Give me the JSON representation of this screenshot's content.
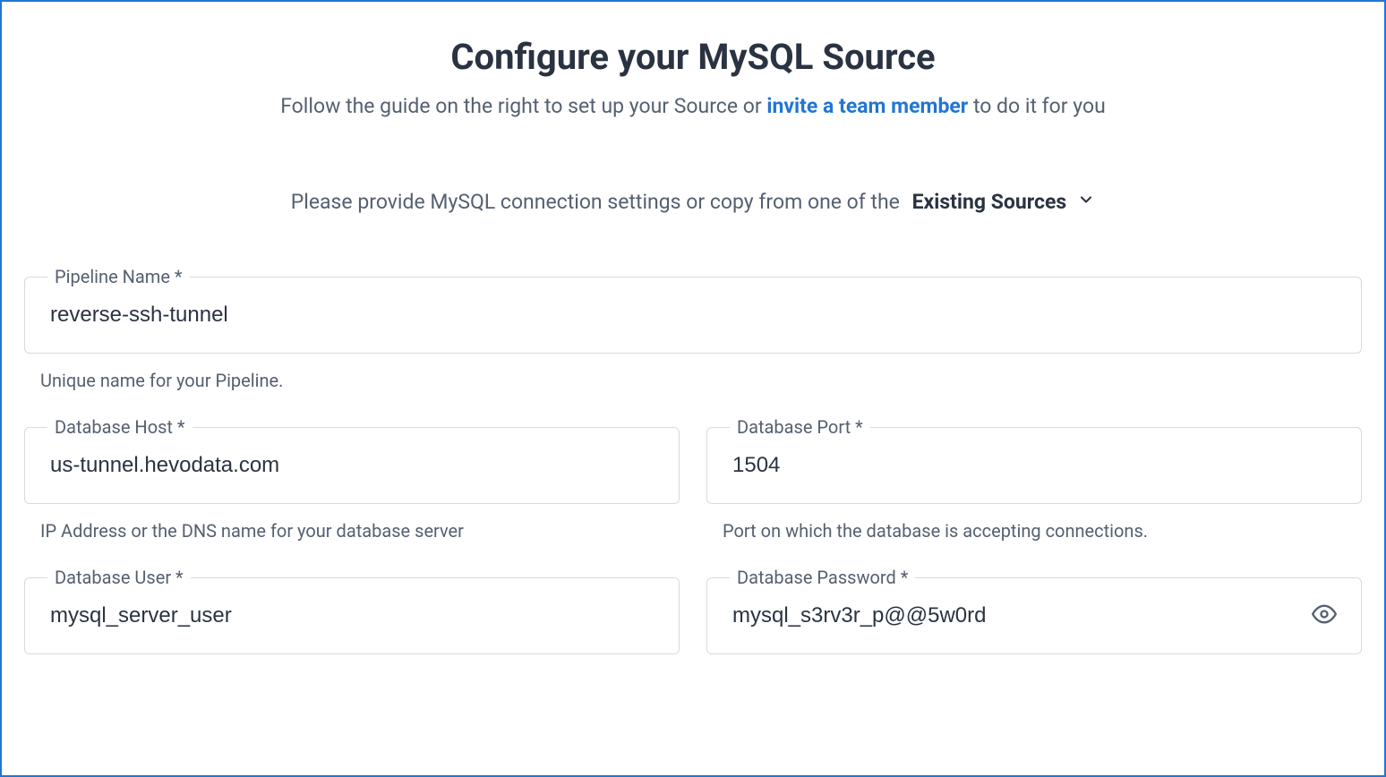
{
  "title": "Configure your MySQL Source",
  "subtitle_prefix": "Follow the guide on the right to set up your Source or ",
  "subtitle_link": "invite a team member",
  "subtitle_suffix": " to do it for you",
  "instruction_prefix": "Please provide MySQL connection settings or copy from one of the",
  "instruction_dropdown": "Existing Sources",
  "fields": {
    "pipeline_name": {
      "label": "Pipeline Name *",
      "value": "reverse-ssh-tunnel",
      "helper": "Unique name for your Pipeline."
    },
    "database_host": {
      "label": "Database Host *",
      "value": "us-tunnel.hevodata.com",
      "helper": "IP Address or the DNS name for your database server"
    },
    "database_port": {
      "label": "Database Port *",
      "value": "1504",
      "helper": "Port on which the database is accepting connections."
    },
    "database_user": {
      "label": "Database User *",
      "value": "mysql_server_user"
    },
    "database_password": {
      "label": "Database Password *",
      "value": "mysql_s3rv3r_p@@5w0rd"
    }
  }
}
